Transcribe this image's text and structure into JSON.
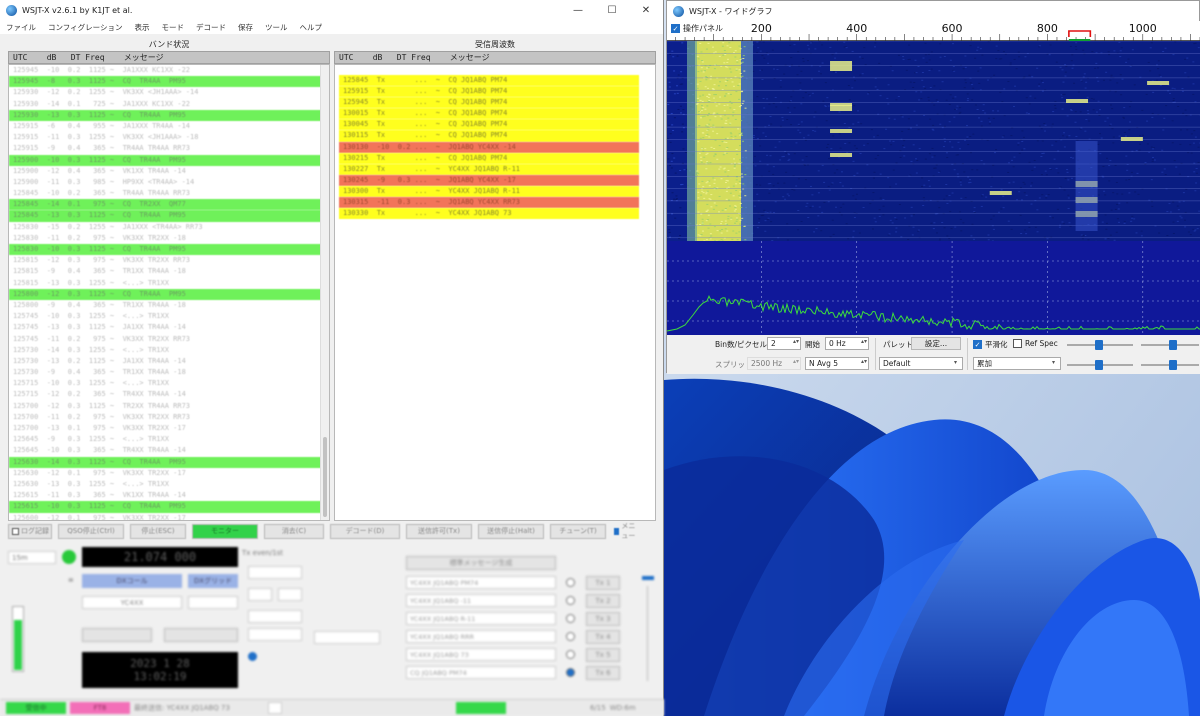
{
  "main_window": {
    "title": "WSJT-X   v2.6.1   by K1JT et al.",
    "window_buttons": {
      "minimize": "—",
      "maximize": "☐",
      "close": "✕"
    },
    "menu": [
      "ファイル",
      "コンフィグレーション",
      "表示",
      "モード",
      "デコード",
      "保存",
      "ツール",
      "ヘルプ"
    ],
    "band_activity": {
      "title": "バンド状況",
      "header": "UTC    dB   DT Freq    メッセージ",
      "rows": [
        {
          "text": "125945  -10  0.2  1125 ~  JA1XXX KC1XX -22",
          "cq": false
        },
        {
          "text": "125945  -8   0.3  1125 ~  CQ  TR4AA  PM95",
          "cq": true
        },
        {
          "text": "125930  -12  0.2  1255 ~  VK3XX <JH1AAA> -14",
          "cq": false
        },
        {
          "text": "125930  -14  0.1   725 ~  JA1XXX KC1XX -22",
          "cq": false
        },
        {
          "text": "125930  -13  0.3  1125 ~  CQ  TR4AA  PM95",
          "cq": true
        },
        {
          "text": "125915  -6   0.4   955 ~  JA1XXX TR4AA -14",
          "cq": false
        },
        {
          "text": "125915  -11  0.3  1255 ~  VK3XX <JH1AAA> -18",
          "cq": false
        },
        {
          "text": "125915  -9   0.4   365 ~  TR4AA TR4AA RR73",
          "cq": false
        },
        {
          "text": "125900  -10  0.3  1125 ~  CQ  TR4AA  PM95",
          "cq": true
        },
        {
          "text": "125900  -12  0.4   365 ~  VK1XX TR4AA -14",
          "cq": false
        },
        {
          "text": "125900  -11  0.3   985 ~  HP9XX <TR4AA> -14",
          "cq": false
        },
        {
          "text": "125845  -10  0.2   365 ~  TR4AA TR4AA RR73",
          "cq": false
        },
        {
          "text": "125845  -14  0.1   975 ~  CQ  TR2XX  QM77",
          "cq": true
        },
        {
          "text": "125845  -13  0.3  1125 ~  CQ  TR4AA  PM95",
          "cq": true
        },
        {
          "text": "125830  -15  0.2  1255 ~  JA1XXX <TR4AA> RR73",
          "cq": false
        },
        {
          "text": "125830  -11  0.2   975 ~  VK3XX TR2XX -18",
          "cq": false
        },
        {
          "text": "125830  -10  0.3  1125 ~  CQ  TR4AA  PM95",
          "cq": true
        },
        {
          "text": "125815  -12  0.3   975 ~  VK3XX TR2XX RR73",
          "cq": false
        },
        {
          "text": "125815  -9   0.4   365 ~  TR1XX TR4AA -18",
          "cq": false
        },
        {
          "text": "125815  -13  0.3  1255 ~  <...> TR1XX",
          "cq": false
        },
        {
          "text": "125800  -12  0.3  1125 ~  CQ  TR4AA  PM95",
          "cq": true
        },
        {
          "text": "125800  -9   0.4   365 ~  TR1XX TR4AA -18",
          "cq": false
        },
        {
          "text": "125745  -10  0.3  1255 ~  <...> TR1XX",
          "cq": false
        },
        {
          "text": "125745  -13  0.3  1125 ~  JA1XX TR4AA -14",
          "cq": false
        },
        {
          "text": "125745  -11  0.2   975 ~  VK3XX TR2XX RR73",
          "cq": false
        },
        {
          "text": "125730  -14  0.3  1255 ~  <...> TR1XX",
          "cq": false
        },
        {
          "text": "125730  -13  0.2  1125 ~  JA1XX TR4AA -14",
          "cq": false
        },
        {
          "text": "125730  -9   0.4   365 ~  TR1XX TR4AA -18",
          "cq": false
        },
        {
          "text": "125715  -10  0.3  1255 ~  <...> TR1XX",
          "cq": false
        },
        {
          "text": "125715  -12  0.2   365 ~  TR4XX TR4AA -14",
          "cq": false
        },
        {
          "text": "125700  -12  0.3  1125 ~  TR2XX TR4AA RR73",
          "cq": false
        },
        {
          "text": "125700  -11  0.2   975 ~  VK3XX TR2XX RR73",
          "cq": false
        },
        {
          "text": "125700  -13  0.1   975 ~  VK3XX TR2XX -17",
          "cq": false
        },
        {
          "text": "125645  -9   0.3  1255 ~  <...> TR1XX",
          "cq": false
        },
        {
          "text": "125645  -10  0.3   365 ~  TR4XX TR4AA -14",
          "cq": false
        },
        {
          "text": "125630  -14  0.3  1125 ~  CQ  TR4AA  PM95",
          "cq": true
        },
        {
          "text": "125630  -12  0.1   975 ~  VK3XX TR2XX -17",
          "cq": false
        },
        {
          "text": "125630  -13  0.3  1255 ~  <...> TR1XX",
          "cq": false
        },
        {
          "text": "125615  -11  0.3   365 ~  VK1XX TR4AA -14",
          "cq": false
        },
        {
          "text": "125615  -10  0.3  1125 ~  CQ  TR4AA  PM95",
          "cq": true
        },
        {
          "text": "125600  -12  0.1   975 ~  VK3XX TR2XX -17",
          "cq": false
        },
        {
          "text": "125600  -13  0.3  1255 ~  <...> TR1XX",
          "cq": false
        }
      ]
    },
    "rx_frequency": {
      "title": "受信周波数",
      "header": "UTC    dB   DT Freq    メッセージ",
      "rows": [
        {
          "text": "125845  Tx       ...  ~  CQ JQ1ABQ PM74",
          "red": false
        },
        {
          "text": "125915  Tx       ...  ~  CQ JQ1ABQ PM74",
          "red": false
        },
        {
          "text": "125945  Tx       ...  ~  CQ JQ1ABQ PM74",
          "red": false
        },
        {
          "text": "130015  Tx       ...  ~  CQ JQ1ABQ PM74",
          "red": false
        },
        {
          "text": "130045  Tx       ...  ~  CQ JQ1ABQ PM74",
          "red": false
        },
        {
          "text": "130115  Tx       ...  ~  CQ JQ1ABQ PM74",
          "red": false
        },
        {
          "text": "130130  -10  0.2 ...  ~  JQ1ABQ YC4XX -14",
          "red": true
        },
        {
          "text": "130215  Tx       ...  ~  CQ JQ1ABQ PM74",
          "red": false
        },
        {
          "text": "130227  Tx       ...  ~  YC4XX JQ1ABQ R-11",
          "red": false
        },
        {
          "text": "130245  -9   0.3 ...  ~  JQ1ABQ YC4XX -17",
          "red": true
        },
        {
          "text": "130300  Tx       ...  ~  YC4XX JQ1ABQ R-11",
          "red": false
        },
        {
          "text": "130315  -11  0.3 ...  ~  JQ1ABQ YC4XX RR73",
          "red": true
        },
        {
          "text": "130330  Tx       ...  ~  YC4XX JQ1ABQ 73",
          "red": false
        }
      ]
    },
    "buttons": [
      "ログ記録",
      "QSO停止(Ctrl)",
      "停止(ESC)",
      "モニター",
      "消去(C)",
      "デコード(D)",
      "送信許可(Tx)",
      "送信停止(Halt)",
      "チューン(T)",
      "メニュー"
    ],
    "frequency_display": "21.074 000",
    "band": "15m",
    "dx_call_label": "DXコール",
    "dx_grid_label": "DXグリッド",
    "dx_call": "YC4XX",
    "datetime_display": "2023 1 28\n13:02:19",
    "tx_period_label": "Tx even/1st",
    "generate_label": "標準メッセージ生成",
    "tx_messages": [
      {
        "msg": "YC4XX JQ1ABQ PM74",
        "label": "Tx 1"
      },
      {
        "msg": "YC4XX JQ1ABQ -11",
        "label": "Tx 2"
      },
      {
        "msg": "YC4XX JQ1ABQ R-11",
        "label": "Tx 3"
      },
      {
        "msg": "YC4XX JQ1ABQ RRR",
        "label": "Tx 4"
      },
      {
        "msg": "YC4XX JQ1ABQ 73",
        "label": "Tx 5"
      },
      {
        "msg": "CQ JQ1ABQ PM74",
        "label": "Tx 6"
      }
    ],
    "status_bar": {
      "receive": "受信中",
      "mode": "FT8",
      "last_tx": "最終送信: YC4XX JQ1ABQ 73",
      "counter": "6/15",
      "wd": "WD:6m"
    }
  },
  "wide_graph": {
    "title": "WSJT-X - ワイドグラフ",
    "control_panel_label": "操作パネル",
    "control_panel_checked": true,
    "freq_ticks": [
      "200",
      "400",
      "600",
      "800",
      "1000"
    ],
    "bins_label": "Bin数/ピクセル",
    "bins_value": "2",
    "start_label": "開始",
    "start_value": "0 Hz",
    "split_label": "スプリット",
    "split_value": "2500  Hz",
    "navg_label": "N Avg",
    "navg_value": "5",
    "palette_label": "パレット",
    "settings_button": "設定...",
    "palette_value": "Default",
    "flatten_label": "平滑化",
    "flatten_checked": true,
    "ref_spec_label": "Ref Spec",
    "ref_spec_checked": false,
    "spectrum_mode": "累加"
  },
  "colors": {
    "cq_row": "#6ff15a",
    "tx_row": "#ffff1e",
    "rx_to_me_row": "#f2745a",
    "accent": "#1f6fc8",
    "waterfall_bg": "#10189a",
    "spectrum_line": "#3ddc3d"
  }
}
